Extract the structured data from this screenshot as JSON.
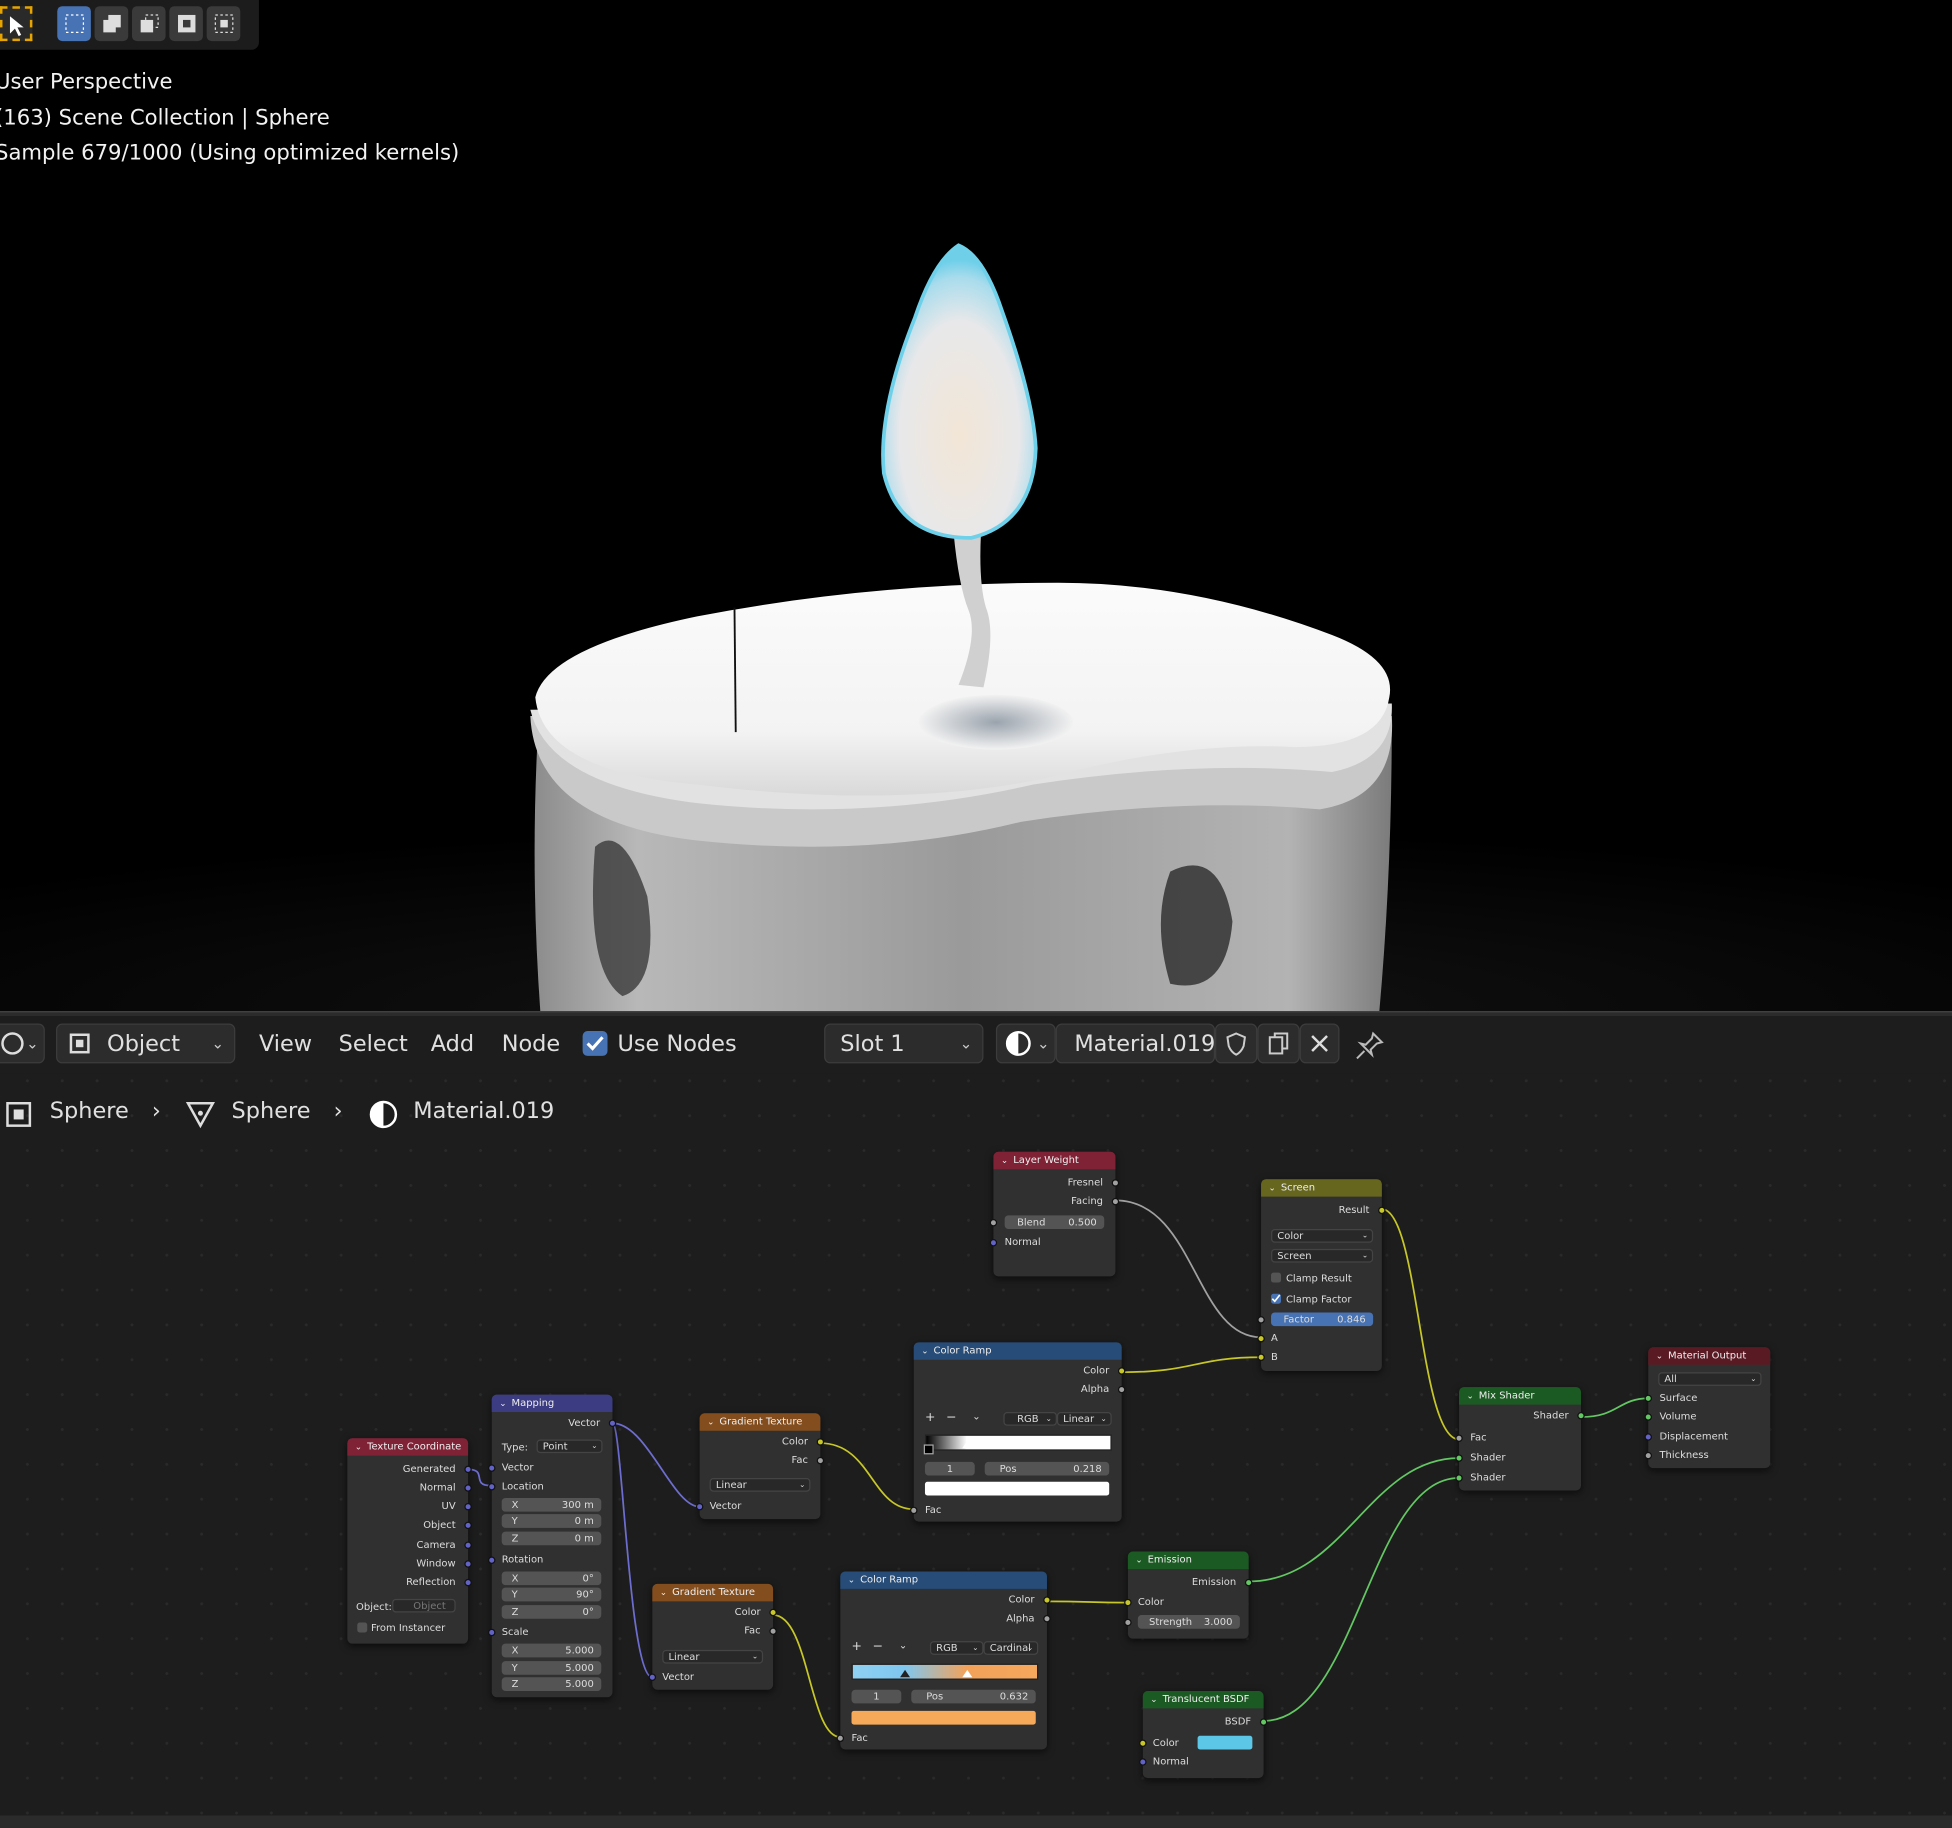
{
  "viewport": {
    "overlay": {
      "view_name": "User Perspective",
      "collection_line": "(163) Scene Collection | Sphere",
      "sample_line": "Sample 679/1000 (Using optimized kernels)"
    },
    "colors": {
      "flame_rim": "#7fd8f0",
      "flame_core": "#f1e9dd",
      "wax": "#f4f4f4"
    }
  },
  "node_editor": {
    "header": {
      "mode": "Object",
      "menus": [
        "View",
        "Select",
        "Add",
        "Node"
      ],
      "use_nodes_label": "Use Nodes",
      "use_nodes_checked": true,
      "slot": "Slot 1",
      "material": "Material.019"
    },
    "breadcrumb": {
      "object": "Sphere",
      "mesh": "Sphere",
      "material": "Material.019"
    },
    "nodes": {
      "texture_coordinate": {
        "title": "Texture Coordinate",
        "outputs": [
          "Generated",
          "Normal",
          "UV",
          "Object",
          "Camera",
          "Window",
          "Reflection"
        ],
        "object_label": "Object:",
        "object_placeholder": "Object",
        "from_instancer": "From Instancer"
      },
      "mapping": {
        "title": "Mapping",
        "output": "Vector",
        "type_label": "Type:",
        "type_value": "Point",
        "input_vector": "Vector",
        "location": "Location",
        "loc": {
          "x": "300 m",
          "y": "0 m",
          "z": "0 m"
        },
        "rotation": "Rotation",
        "rot": {
          "x": "0°",
          "y": "90°",
          "z": "0°"
        },
        "scale": "Scale",
        "scl": {
          "x": "5.000",
          "y": "5.000",
          "z": "5.000"
        },
        "axis": {
          "x": "X",
          "y": "Y",
          "z": "Z"
        }
      },
      "gradient_1": {
        "title": "Gradient Texture",
        "color": "Color",
        "fac": "Fac",
        "mode": "Linear",
        "vector": "Vector"
      },
      "gradient_2": {
        "title": "Gradient Texture",
        "color": "Color",
        "fac": "Fac",
        "mode": "Linear",
        "vector": "Vector"
      },
      "color_ramp_1": {
        "title": "Color Ramp",
        "color": "Color",
        "alpha": "Alpha",
        "color_mode": "RGB",
        "interp": "Linear",
        "index": "1",
        "pos_label": "Pos",
        "pos": "0.218",
        "fac": "Fac"
      },
      "color_ramp_2": {
        "title": "Color Ramp",
        "color": "Color",
        "alpha": "Alpha",
        "color_mode": "RGB",
        "interp": "Cardinal",
        "index": "1",
        "pos_label": "Pos",
        "pos": "0.632",
        "fac": "Fac"
      },
      "layer_weight": {
        "title": "Layer Weight",
        "fresnel": "Fresnel",
        "facing": "Facing",
        "blend_label": "Blend",
        "blend": "0.500",
        "normal": "Normal"
      },
      "screen": {
        "title": "Screen",
        "result": "Result",
        "type": "Color",
        "blend_mode": "Screen",
        "clamp_result": "Clamp Result",
        "clamp_factor": "Clamp Factor",
        "factor_label": "Factor",
        "factor": "0.846",
        "a": "A",
        "b": "B"
      },
      "emission": {
        "title": "Emission",
        "output": "Emission",
        "color": "Color",
        "strength_label": "Strength",
        "strength": "3.000"
      },
      "translucent": {
        "title": "Translucent BSDF",
        "output": "BSDF",
        "color": "Color",
        "normal": "Normal"
      },
      "mix_shader": {
        "title": "Mix Shader",
        "output": "Shader",
        "fac": "Fac",
        "shader1": "Shader",
        "shader2": "Shader"
      },
      "material_output": {
        "title": "Material Output",
        "target": "All",
        "surface": "Surface",
        "volume": "Volume",
        "displacement": "Displacement",
        "thickness": "Thickness"
      }
    },
    "colors": {
      "translucent_swatch": "#5cc7e6",
      "ramp2_swatch": "#f7a95a",
      "ramp1_swatch": "#ffffff"
    }
  }
}
